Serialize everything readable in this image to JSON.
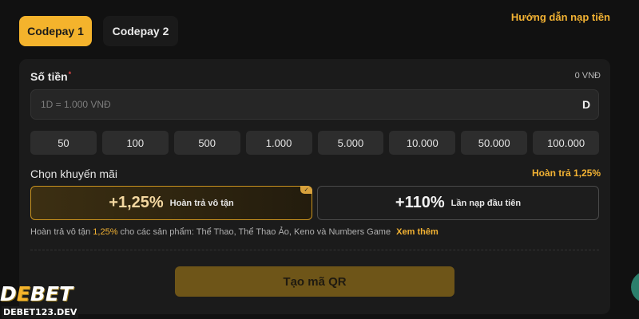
{
  "tabs": [
    {
      "label": "Codepay 1",
      "active": true
    },
    {
      "label": "Codepay 2",
      "active": false
    }
  ],
  "guide_link": "Hướng dẫn nạp tiền",
  "amount": {
    "label": "Số tiền",
    "required_mark": "*",
    "balance": "0 VNĐ",
    "placeholder": "1D = 1.000 VNĐ",
    "value": "",
    "currency_icon": "D"
  },
  "quick_amounts": [
    "50",
    "100",
    "500",
    "1.000",
    "5.000",
    "10.000",
    "50.000",
    "100.000"
  ],
  "promo": {
    "label": "Chọn khuyến mãi",
    "selected_text": "Hoàn trả 1,25%",
    "cards": [
      {
        "percent": "+1,25%",
        "desc": "Hoàn trả vô tận",
        "selected": true,
        "check_icon": "check-icon"
      },
      {
        "percent": "+110%",
        "desc": "Lần nạp đầu tiên",
        "selected": false
      }
    ],
    "note_before": "Hoàn trả vô tận",
    "note_highlight": "1,25%",
    "note_after": "cho các sản phẩm: Thể Thao, Thể Thao Ảo, Keno và Numbers Game",
    "see_more": "Xem thêm"
  },
  "submit_button": "Tạo mã QR",
  "watermark": {
    "logo_part1": "D",
    "logo_part2": "E",
    "logo_part3": "BET",
    "domain": "DEBET123.DEV"
  },
  "colors": {
    "accent": "#f4b32c",
    "background": "#111111",
    "panel": "#1b1b1b",
    "button_disabled": "#6e5518"
  }
}
